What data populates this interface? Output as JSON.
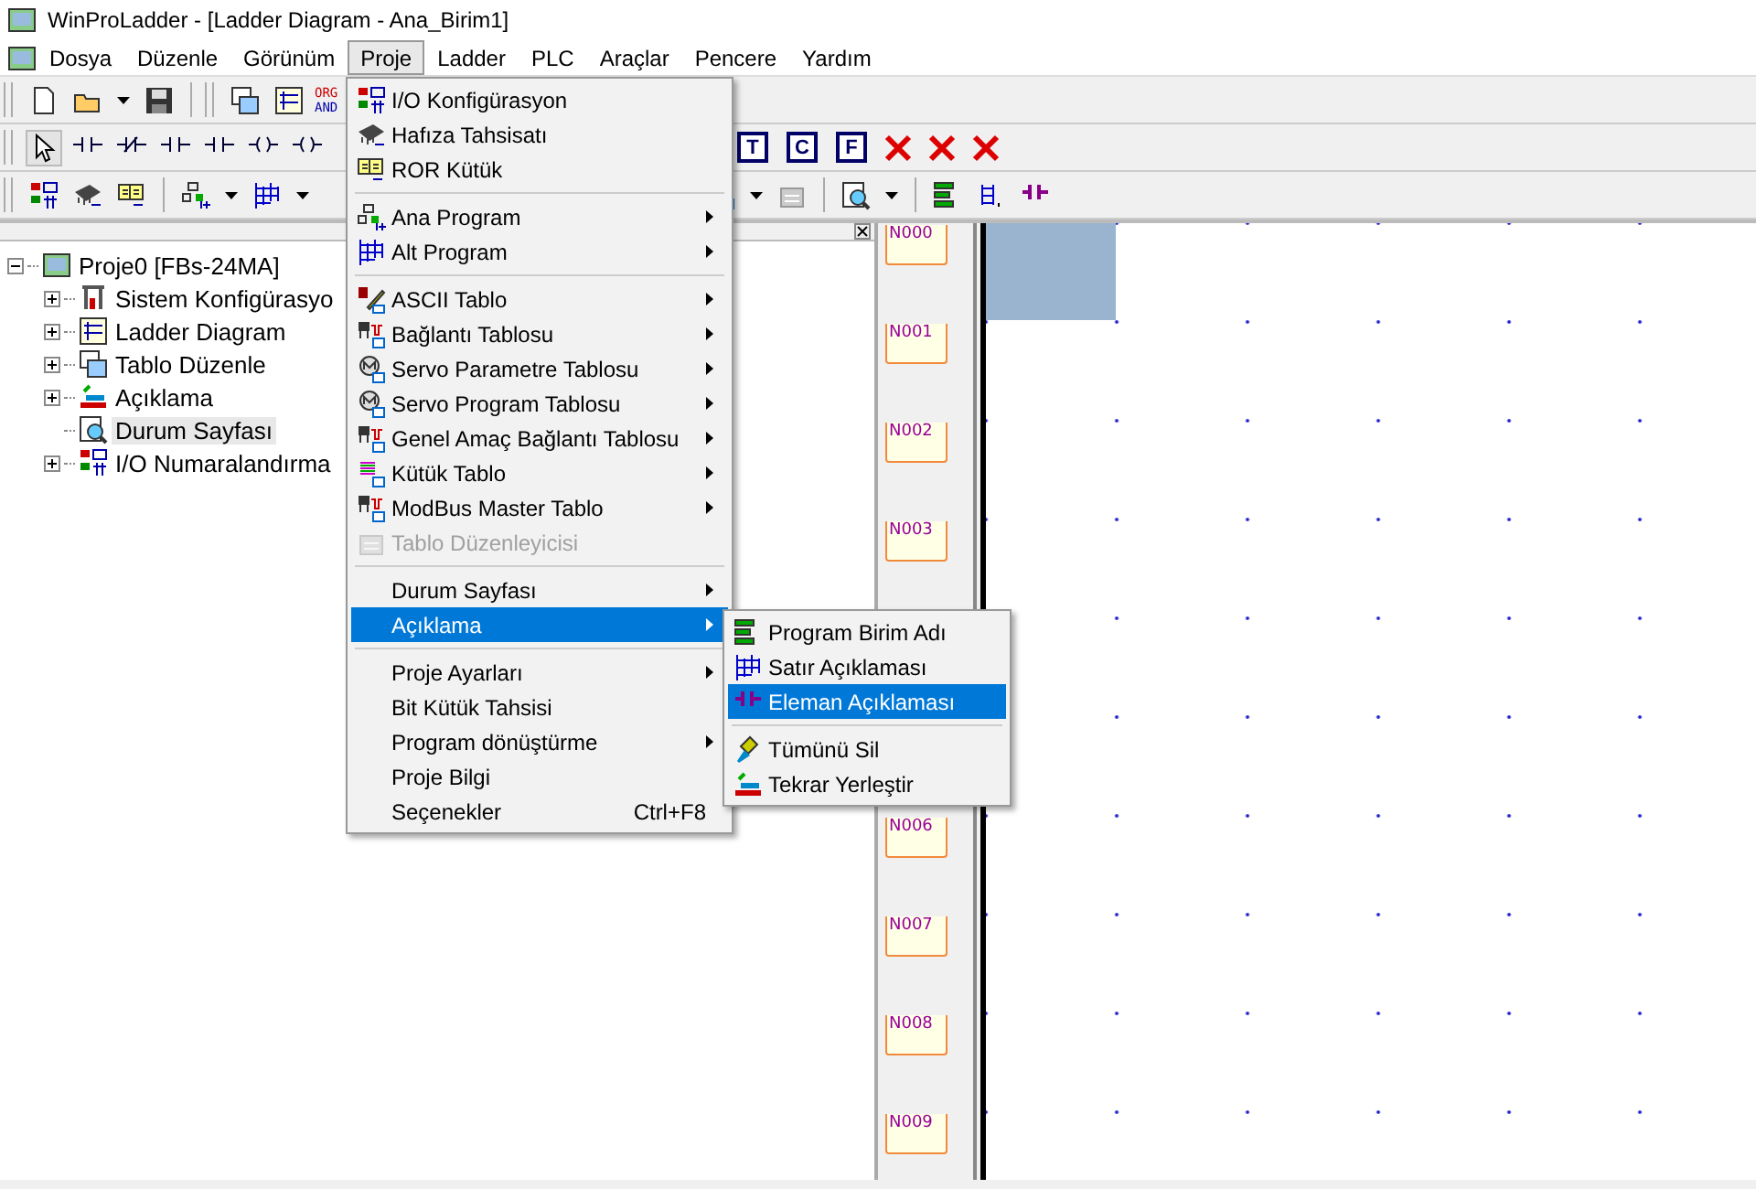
{
  "window": {
    "title": "WinProLadder - [Ladder Diagram - Ana_Birim1]"
  },
  "menu_bar": [
    {
      "label": "Dosya",
      "selected": false
    },
    {
      "label": "Düzenle",
      "selected": false
    },
    {
      "label": "Görünüm",
      "selected": false
    },
    {
      "label": "Proje",
      "selected": true
    },
    {
      "label": "Ladder",
      "selected": false
    },
    {
      "label": "PLC",
      "selected": false
    },
    {
      "label": "Araçlar",
      "selected": false
    },
    {
      "label": "Pencere",
      "selected": false
    },
    {
      "label": "Yardım",
      "selected": false
    }
  ],
  "toolbar": {
    "org_and_icon": [
      "ORG",
      "AND"
    ],
    "letter_buttons": [
      "T",
      "C",
      "F"
    ]
  },
  "project_tree": {
    "root": {
      "label": "Proje0 [FBs-24MA]",
      "expanded": true,
      "children": [
        {
          "label": "Sistem Konfigürasyo",
          "kind": "folder",
          "selected": false
        },
        {
          "label": "Ladder Diagram",
          "kind": "folder",
          "selected": false
        },
        {
          "label": "Tablo Düzenle",
          "kind": "folder",
          "selected": false
        },
        {
          "label": "Açıklama",
          "kind": "folder",
          "selected": false
        },
        {
          "label": "Durum Sayfası",
          "kind": "leaf",
          "selected": true
        },
        {
          "label": "I/O Numaralandırma",
          "kind": "folder",
          "selected": false
        }
      ]
    }
  },
  "rungs_upper": [
    "N000",
    "N001",
    "N002",
    "N003"
  ],
  "rungs_lower": [
    "N006",
    "N007",
    "N008",
    "N009"
  ],
  "proje_menu": [
    {
      "kind": "item",
      "label": "I/O Konfigürasyon",
      "submenu": false,
      "disabled": false,
      "selected": false
    },
    {
      "kind": "item",
      "label": "Hafıza Tahsisatı",
      "submenu": false,
      "disabled": false,
      "selected": false
    },
    {
      "kind": "item",
      "label": "ROR Kütük",
      "submenu": false,
      "disabled": false,
      "selected": false
    },
    {
      "kind": "separator"
    },
    {
      "kind": "item",
      "label": "Ana Program",
      "submenu": true,
      "disabled": false,
      "selected": false
    },
    {
      "kind": "item",
      "label": "Alt Program",
      "submenu": true,
      "disabled": false,
      "selected": false
    },
    {
      "kind": "separator"
    },
    {
      "kind": "item",
      "label": "ASCII Tablo",
      "submenu": true,
      "disabled": false,
      "selected": false
    },
    {
      "kind": "item",
      "label": "Bağlantı Tablosu",
      "submenu": true,
      "disabled": false,
      "selected": false
    },
    {
      "kind": "item",
      "label": "Servo Parametre Tablosu",
      "submenu": true,
      "disabled": false,
      "selected": false
    },
    {
      "kind": "item",
      "label": "Servo Program Tablosu",
      "submenu": true,
      "disabled": false,
      "selected": false
    },
    {
      "kind": "item",
      "label": "Genel Amaç Bağlantı Tablosu",
      "submenu": true,
      "disabled": false,
      "selected": false
    },
    {
      "kind": "item",
      "label": "Kütük Tablo",
      "submenu": true,
      "disabled": false,
      "selected": false
    },
    {
      "kind": "item",
      "label": "ModBus Master Tablo",
      "submenu": true,
      "disabled": false,
      "selected": false
    },
    {
      "kind": "item",
      "label": "Tablo Düzenleyicisi",
      "submenu": false,
      "disabled": true,
      "selected": false
    },
    {
      "kind": "separator"
    },
    {
      "kind": "item",
      "label": "Durum Sayfası",
      "submenu": true,
      "disabled": false,
      "selected": false
    },
    {
      "kind": "item",
      "label": "Açıklama",
      "submenu": true,
      "disabled": false,
      "selected": true
    },
    {
      "kind": "separator"
    },
    {
      "kind": "item",
      "label": "Proje Ayarları",
      "submenu": true,
      "disabled": false,
      "selected": false
    },
    {
      "kind": "item",
      "label": "Bit  Kütük Tahsisi",
      "submenu": false,
      "disabled": false,
      "selected": false
    },
    {
      "kind": "item",
      "label": "Program dönüştürme",
      "submenu": true,
      "disabled": false,
      "selected": false
    },
    {
      "kind": "item",
      "label": "Proje Bilgi",
      "submenu": false,
      "disabled": false,
      "selected": false
    },
    {
      "kind": "item",
      "label": "Seçenekler",
      "shortcut": "Ctrl+F8",
      "submenu": false,
      "disabled": false,
      "selected": false
    }
  ],
  "aciklama_submenu": [
    {
      "kind": "item",
      "label": "Program Birim Adı",
      "selected": false
    },
    {
      "kind": "item",
      "label": "Satır Açıklaması",
      "selected": false
    },
    {
      "kind": "item",
      "label": "Eleman Açıklaması",
      "selected": true
    },
    {
      "kind": "separator"
    },
    {
      "kind": "item",
      "label": "Tümünü Sil",
      "selected": false
    },
    {
      "kind": "item",
      "label": "Tekrar Yerleştir",
      "selected": false
    }
  ]
}
